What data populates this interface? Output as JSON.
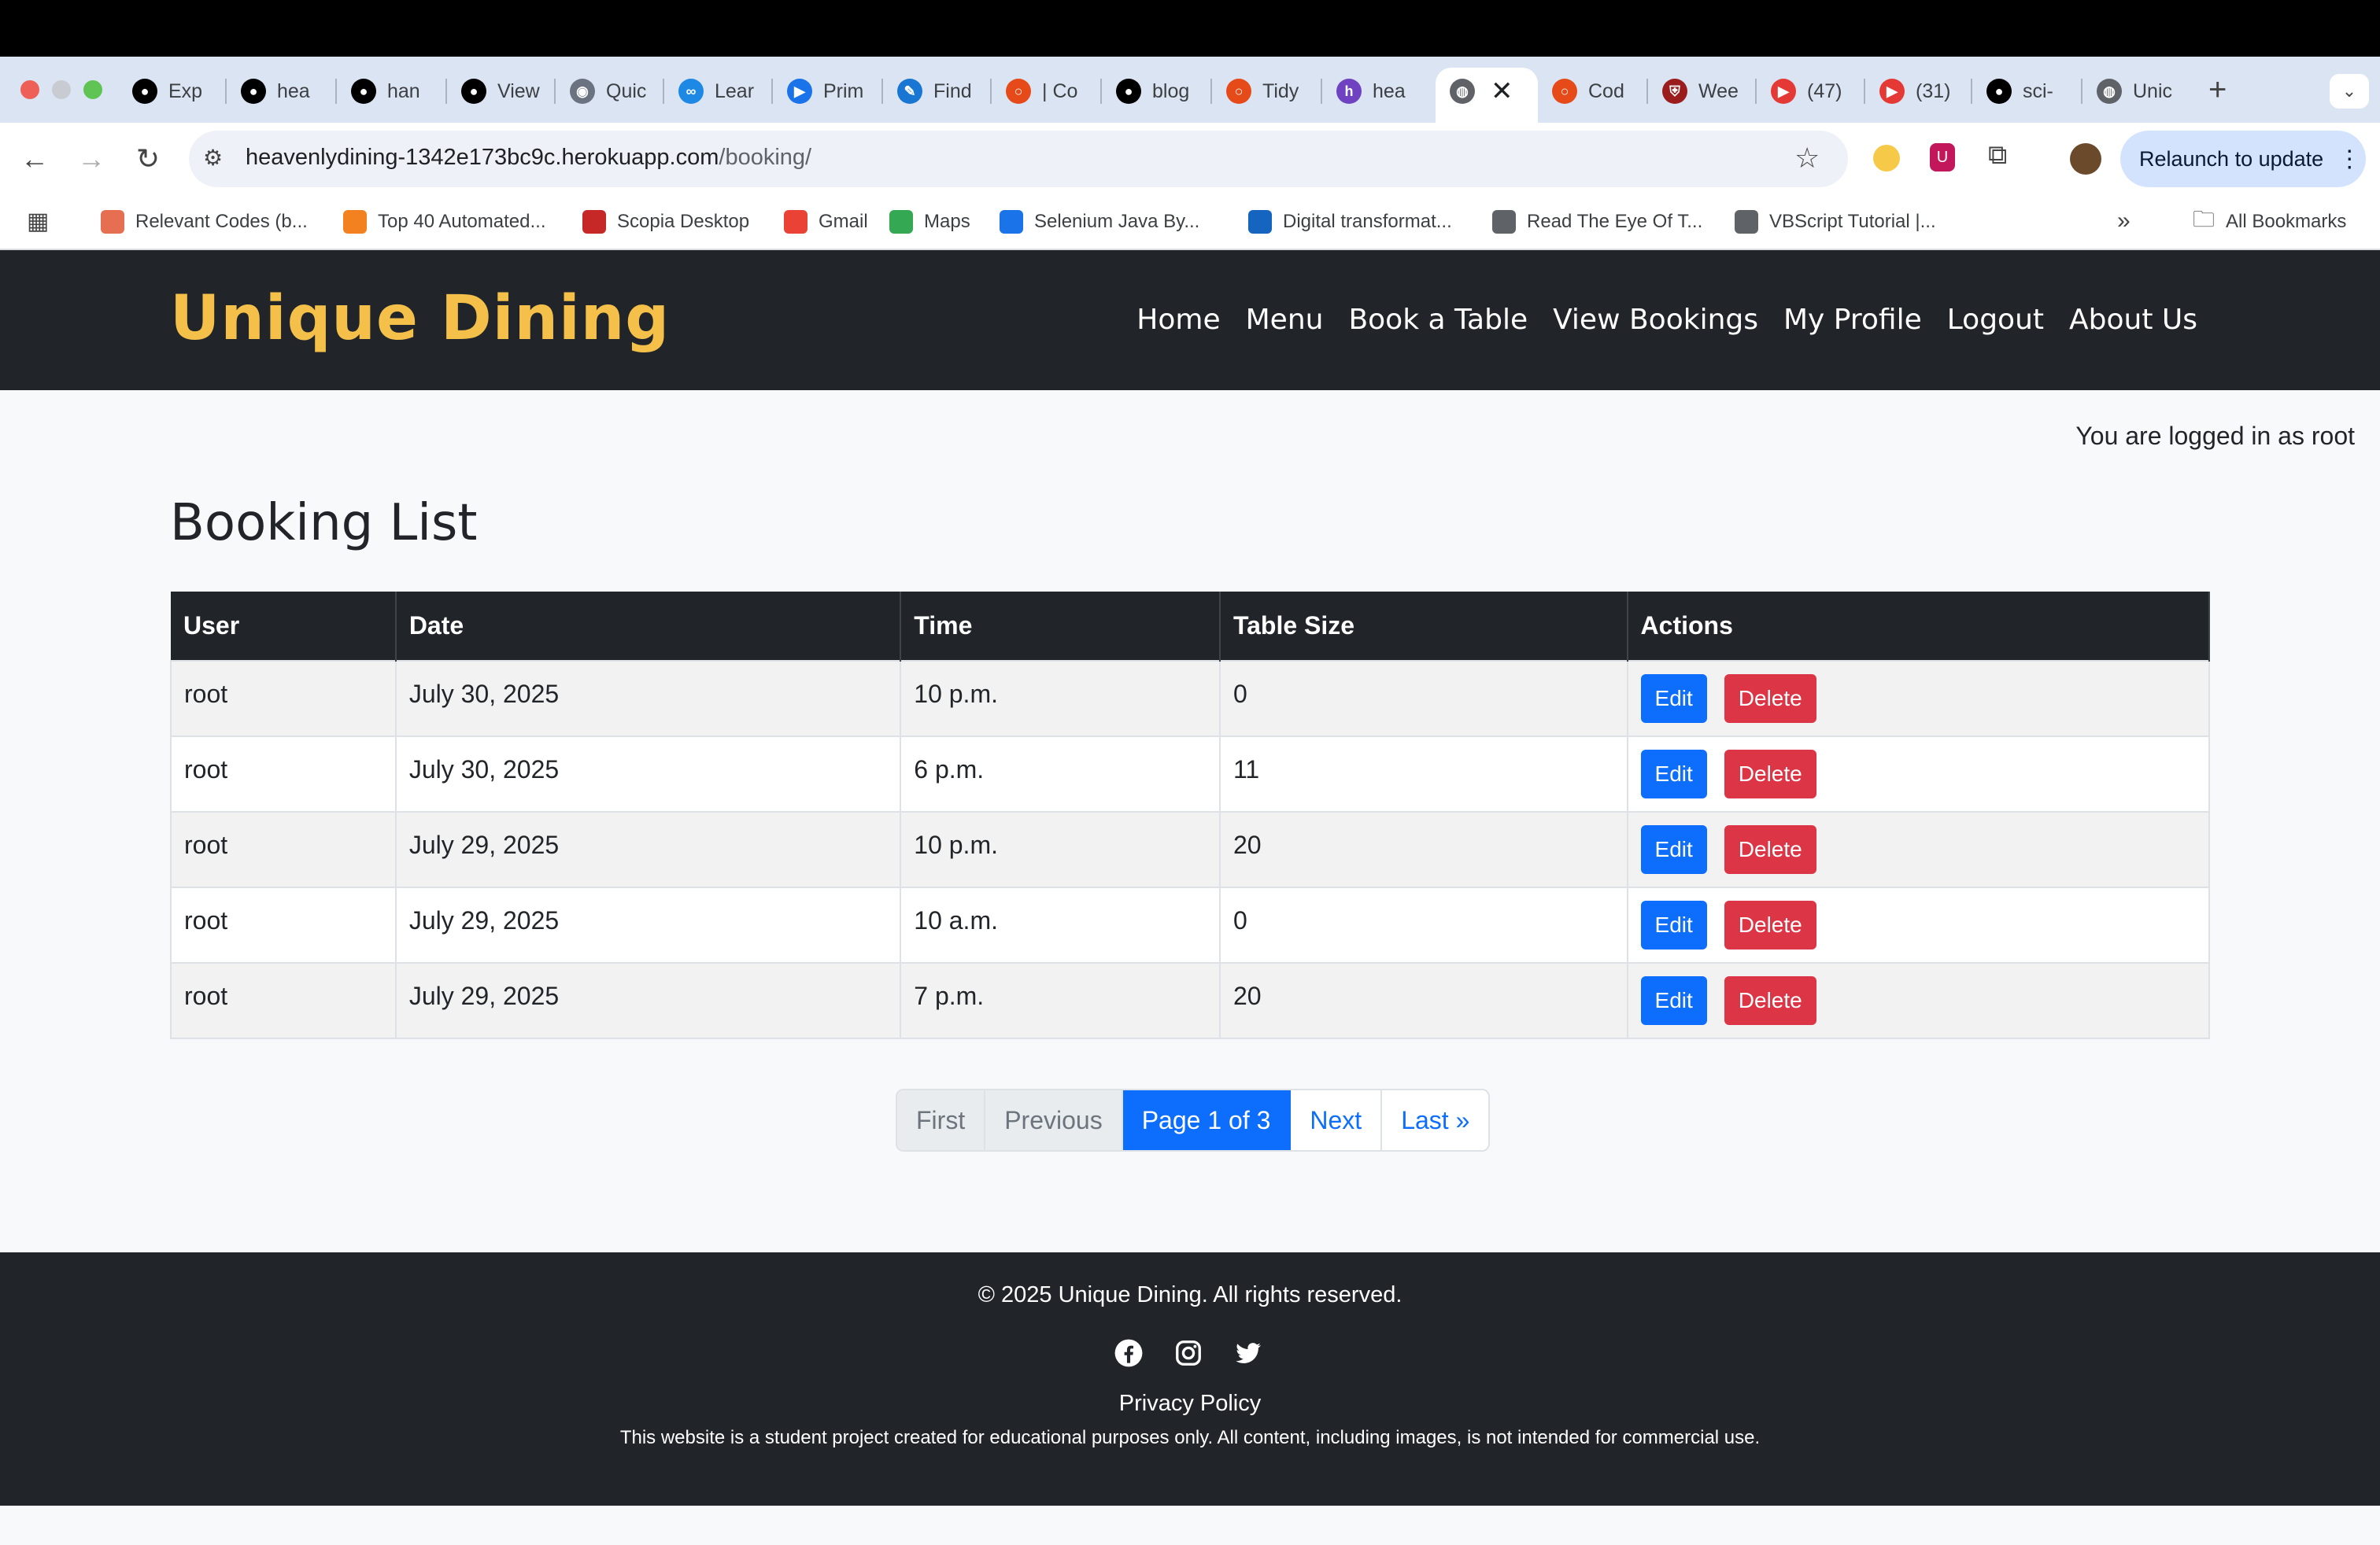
{
  "browser": {
    "tabs": [
      {
        "label": "Exp",
        "icon": "github-icon"
      },
      {
        "label": "hea",
        "icon": "github-icon"
      },
      {
        "label": "han",
        "icon": "github-icon"
      },
      {
        "label": "View",
        "icon": "github-icon"
      },
      {
        "label": "Quic",
        "icon": "eye-icon"
      },
      {
        "label": "Lear",
        "icon": "owl-icon"
      },
      {
        "label": "Prim",
        "icon": "play-icon"
      },
      {
        "label": "Find",
        "icon": "pen-icon"
      },
      {
        "label": "| Co",
        "icon": "circle-icon"
      },
      {
        "label": "blog",
        "icon": "github-icon"
      },
      {
        "label": "Tidy",
        "icon": "circle-icon"
      },
      {
        "label": "hea",
        "icon": "heroku-icon"
      },
      {
        "label": "",
        "icon": "globe-icon"
      },
      {
        "label": "Cod",
        "icon": "circle-icon"
      },
      {
        "label": "Wee",
        "icon": "shield-icon"
      },
      {
        "label": "(47)",
        "icon": "youtube-icon"
      },
      {
        "label": "(31)",
        "icon": "youtube-icon"
      },
      {
        "label": "sci-",
        "icon": "github-icon"
      },
      {
        "label": "Unic",
        "icon": "globe-icon"
      }
    ],
    "url_host": "heavenlydining-1342e173bc9c.herokuapp.com",
    "url_path": "/booking/",
    "relaunch_label": "Relaunch to update",
    "bookmarks": [
      "Relevant Codes (b...",
      "Top 40 Automated...",
      "Scopia Desktop",
      "Gmail",
      "Maps",
      "Selenium Java By...",
      "Digital transformat...",
      "Read The Eye Of T...",
      "VBScript Tutorial |..."
    ],
    "all_bookmarks": "All Bookmarks",
    "overflow": "»"
  },
  "site": {
    "brand": "Unique Dining",
    "brand_color": "#f4c04a",
    "nav": [
      "Home",
      "Menu",
      "Book a Table",
      "View Bookings",
      "My Profile",
      "Logout",
      "About Us"
    ],
    "logged_in": "You are logged in as root",
    "page_title": "Booking List"
  },
  "table": {
    "headers": [
      "User",
      "Date",
      "Time",
      "Table Size",
      "Actions"
    ],
    "rows": [
      {
        "user": "root",
        "date": "July 30, 2025",
        "time": "10 p.m.",
        "size": "0"
      },
      {
        "user": "root",
        "date": "July 30, 2025",
        "time": "6 p.m.",
        "size": "11"
      },
      {
        "user": "root",
        "date": "July 29, 2025",
        "time": "10 p.m.",
        "size": "20"
      },
      {
        "user": "root",
        "date": "July 29, 2025",
        "time": "10 a.m.",
        "size": "0"
      },
      {
        "user": "root",
        "date": "July 29, 2025",
        "time": "7 p.m.",
        "size": "20"
      }
    ],
    "edit_label": "Edit",
    "delete_label": "Delete"
  },
  "pagination": {
    "first": "First",
    "previous": "Previous",
    "current": "Page 1 of 3",
    "next": "Next",
    "last": "Last »"
  },
  "footer": {
    "copyright": "© 2025 Unique Dining. All rights reserved.",
    "privacy": "Privacy Policy",
    "disclaimer": "This website is a student project created for educational purposes only. All content, including images, is not intended for commercial use."
  }
}
